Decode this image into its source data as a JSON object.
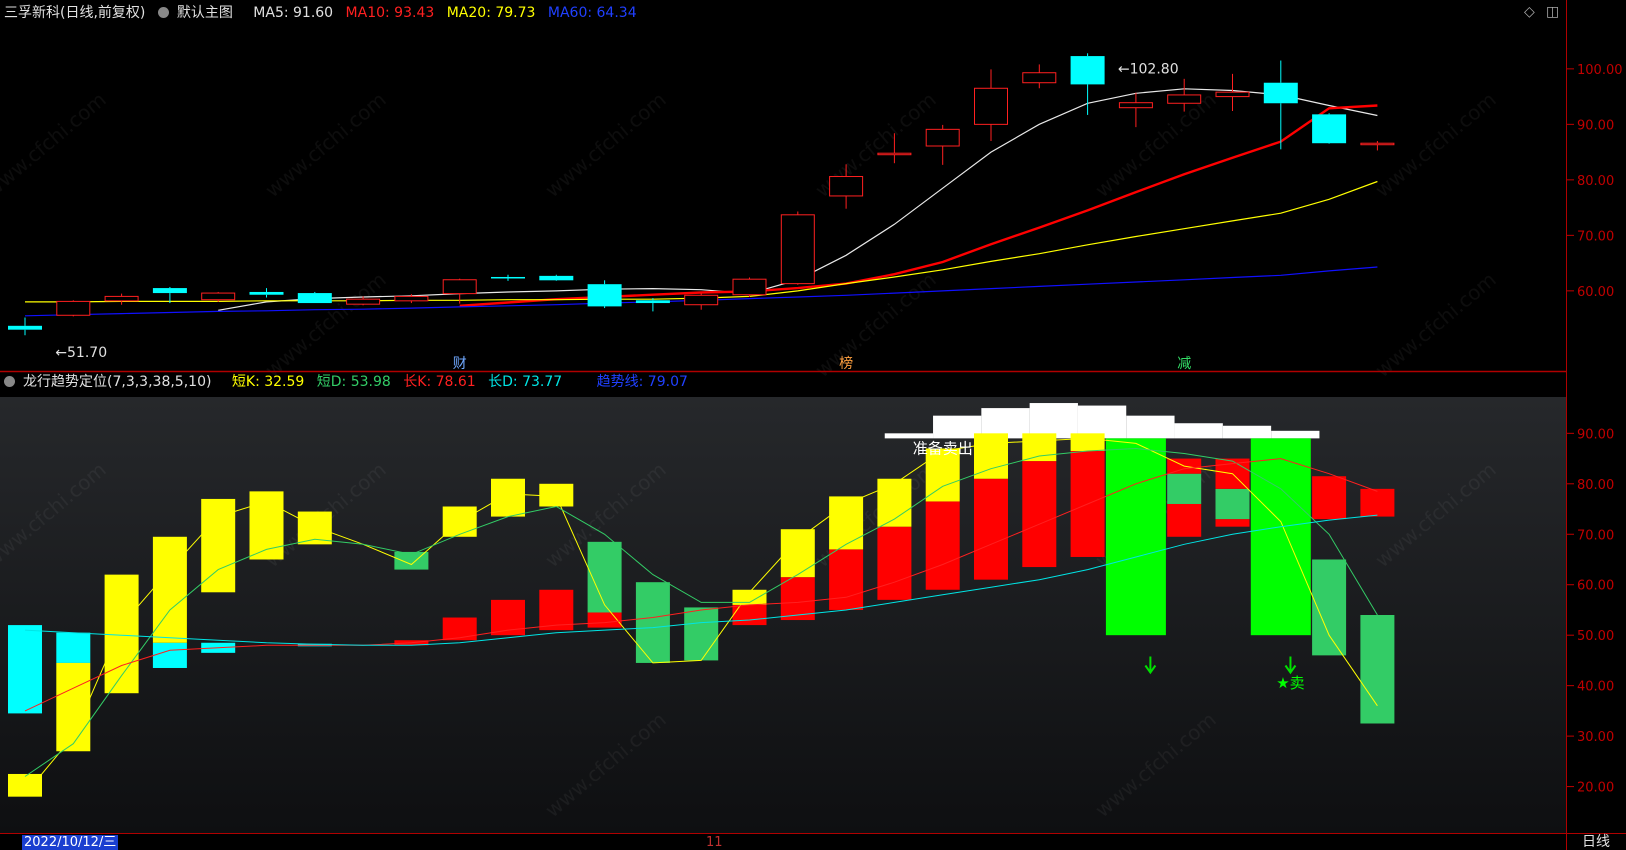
{
  "colors": {
    "bg": "#000000",
    "up": "#ff2020",
    "down": "#00ffff",
    "ma5": "#e8e8e8",
    "ma10": "#ff0000",
    "ma20": "#ffff00",
    "ma60": "#1010ff",
    "axis": "#c00000",
    "yellow": "#ffff00",
    "red": "#ff0000",
    "cyan": "#00ffff",
    "ltgreen": "#33cc66",
    "green": "#00ff00",
    "white": "#ffffff"
  },
  "header": {
    "stock": "三孚新科",
    "period": "(日线,前复权)",
    "main_label": "默认主图",
    "ma5": "MA5: 91.60",
    "ma10": "MA10: 93.43",
    "ma20": "MA20: 79.73",
    "ma60": "MA60: 64.34"
  },
  "toolbar": {
    "diamond_icon": "◇",
    "layout_icon": "◫"
  },
  "indicator": {
    "name": "龙行趋势定位(7,3,3,38,5,10)",
    "short_k": "短K: 32.59",
    "short_d": "短D: 53.98",
    "long_k": "长K: 78.61",
    "long_d": "长D: 73.77",
    "trend": "趋势线: 79.07"
  },
  "footer": {
    "date": "2022/10/12/三",
    "month_mark": "11",
    "period_btn": "日线"
  },
  "chart_data": [
    {
      "type": "candlestick",
      "yticks": [
        60,
        70,
        80,
        90,
        100
      ],
      "ytick_labels": [
        "60.00",
        "70.00",
        "80.00",
        "90.00",
        "100.00"
      ],
      "ylim": [
        47,
        107
      ],
      "annotations": [
        {
          "text": "←51.70",
          "x": 1,
          "y": 51.7
        },
        {
          "text": "←102.80",
          "x": 23,
          "y": 102.8
        }
      ],
      "event_labels": [
        {
          "text": "财",
          "x": 9,
          "color": "#6fa8ff"
        },
        {
          "text": "榜",
          "x": 17,
          "color": "#ffa040"
        },
        {
          "text": "减",
          "x": 24,
          "color": "#33dd66"
        }
      ],
      "candles": [
        {
          "o": 53.7,
          "h": 55.2,
          "l": 52.0,
          "c": 53.0
        },
        {
          "o": 55.6,
          "h": 58.3,
          "l": 55.4,
          "c": 58.1
        },
        {
          "o": 58.2,
          "h": 59.5,
          "l": 57.5,
          "c": 59.0
        },
        {
          "o": 60.5,
          "h": 60.7,
          "l": 57.8,
          "c": 59.6
        },
        {
          "o": 58.4,
          "h": 59.8,
          "l": 58.0,
          "c": 59.6
        },
        {
          "o": 59.8,
          "h": 60.5,
          "l": 58.8,
          "c": 59.3
        },
        {
          "o": 59.6,
          "h": 59.8,
          "l": 57.8,
          "c": 57.8
        },
        {
          "o": 57.6,
          "h": 59.0,
          "l": 57.4,
          "c": 58.5
        },
        {
          "o": 58.2,
          "h": 59.4,
          "l": 57.8,
          "c": 59.0
        },
        {
          "o": 59.5,
          "h": 62.2,
          "l": 57.7,
          "c": 62.0
        },
        {
          "o": 62.5,
          "h": 62.9,
          "l": 61.8,
          "c": 62.3
        },
        {
          "o": 62.7,
          "h": 62.9,
          "l": 61.8,
          "c": 61.9
        },
        {
          "o": 61.2,
          "h": 61.9,
          "l": 56.9,
          "c": 57.2
        },
        {
          "o": 58.3,
          "h": 58.7,
          "l": 56.3,
          "c": 57.8
        },
        {
          "o": 57.5,
          "h": 59.6,
          "l": 56.6,
          "c": 59.2
        },
        {
          "o": 59.3,
          "h": 62.4,
          "l": 58.9,
          "c": 62.1
        },
        {
          "o": 61.3,
          "h": 74.3,
          "l": 61.1,
          "c": 73.7
        },
        {
          "o": 77.1,
          "h": 82.8,
          "l": 74.8,
          "c": 80.6
        },
        {
          "o": 84.8,
          "h": 88.4,
          "l": 83.0,
          "c": 84.8
        },
        {
          "o": 86.1,
          "h": 89.9,
          "l": 82.7,
          "c": 89.1
        },
        {
          "o": 90.0,
          "h": 99.9,
          "l": 87.0,
          "c": 96.5
        },
        {
          "o": 97.5,
          "h": 100.8,
          "l": 96.5,
          "c": 99.3
        },
        {
          "o": 102.3,
          "h": 102.8,
          "l": 91.7,
          "c": 97.2
        },
        {
          "o": 93.0,
          "h": 95.7,
          "l": 89.5,
          "c": 93.9
        },
        {
          "o": 93.8,
          "h": 98.2,
          "l": 92.3,
          "c": 95.3
        },
        {
          "o": 95.0,
          "h": 99.1,
          "l": 92.4,
          "c": 95.8
        },
        {
          "o": 97.5,
          "h": 101.5,
          "l": 85.5,
          "c": 93.8
        },
        {
          "o": 91.8,
          "h": 92.0,
          "l": 86.5,
          "c": 86.6
        },
        {
          "o": 86.6,
          "h": 87.0,
          "l": 85.3,
          "c": 86.6
        }
      ],
      "series": [
        {
          "name": "MA5",
          "values": [
            null,
            null,
            null,
            null,
            56.5,
            58.0,
            58.6,
            58.9,
            59.1,
            59.5,
            59.8,
            60.0,
            60.3,
            60.4,
            60.2,
            59.5,
            62.0,
            66.4,
            72.0,
            78.5,
            85.0,
            90.0,
            93.8,
            95.6,
            96.4,
            96.1,
            95.3,
            93.4,
            91.6
          ]
        },
        {
          "name": "MA10",
          "values": [
            null,
            null,
            null,
            null,
            null,
            null,
            null,
            null,
            null,
            57.3,
            57.9,
            58.5,
            58.9,
            59.3,
            59.7,
            59.9,
            60.5,
            61.3,
            63.0,
            65.2,
            68.4,
            71.4,
            74.5,
            77.8,
            81.0,
            84.0,
            86.9,
            92.9,
            93.4
          ]
        },
        {
          "name": "MA20",
          "values": [
            58.0,
            58.0,
            58.1,
            58.1,
            58.1,
            58.2,
            58.2,
            58.2,
            58.3,
            58.3,
            58.4,
            58.4,
            58.5,
            58.5,
            58.7,
            59.0,
            60.0,
            61.3,
            62.5,
            63.8,
            65.3,
            66.7,
            68.3,
            69.8,
            71.2,
            72.6,
            74.0,
            76.5,
            79.7
          ]
        },
        {
          "name": "MA60",
          "values": [
            55.5,
            55.7,
            55.9,
            56.1,
            56.3,
            56.4,
            56.6,
            56.7,
            56.9,
            57.1,
            57.3,
            57.5,
            57.8,
            58.0,
            58.3,
            58.6,
            58.9,
            59.2,
            59.6,
            60.0,
            60.4,
            60.8,
            61.2,
            61.6,
            62.0,
            62.4,
            62.8,
            63.6,
            64.3
          ]
        }
      ]
    },
    {
      "type": "bar",
      "yticks": [
        20,
        30,
        40,
        50,
        60,
        70,
        80,
        90
      ],
      "ytick_labels": [
        "20.00",
        "30.00",
        "40.00",
        "50.00",
        "60.00",
        "70.00",
        "80.00",
        "90.00"
      ],
      "ylim": [
        11,
        97
      ],
      "bars": [
        {
          "x": 0,
          "from": 34.5,
          "to": 52.0,
          "color": "cyan"
        },
        {
          "x": 0,
          "from": 18.0,
          "to": 22.5,
          "color": "yellow"
        },
        {
          "x": 1,
          "from": 44.5,
          "to": 50.5,
          "color": "cyan"
        },
        {
          "x": 1,
          "from": 27.0,
          "to": 44.5,
          "color": "yellow"
        },
        {
          "x": 2,
          "from": 38.5,
          "to": 62.0,
          "color": "yellow"
        },
        {
          "x": 3,
          "from": 43.5,
          "to": 48.5,
          "color": "cyan"
        },
        {
          "x": 3,
          "from": 48.5,
          "to": 69.5,
          "color": "yellow"
        },
        {
          "x": 4,
          "from": 46.5,
          "to": 48.5,
          "color": "cyan"
        },
        {
          "x": 4,
          "from": 58.5,
          "to": 77.0,
          "color": "yellow"
        },
        {
          "x": 5,
          "from": 65.0,
          "to": 78.5,
          "color": "yellow"
        },
        {
          "x": 6,
          "from": 47.8,
          "to": 48.3,
          "color": "cyan"
        },
        {
          "x": 6,
          "from": 68.0,
          "to": 74.5,
          "color": "yellow"
        },
        {
          "x": 8,
          "from": 63.0,
          "to": 66.5,
          "color": "ltgreen"
        },
        {
          "x": 8,
          "from": 48.0,
          "to": 49.0,
          "color": "red"
        },
        {
          "x": 9,
          "from": 49.0,
          "to": 53.5,
          "color": "red"
        },
        {
          "x": 9,
          "from": 69.5,
          "to": 75.5,
          "color": "yellow"
        },
        {
          "x": 10,
          "from": 50.0,
          "to": 57.0,
          "color": "red"
        },
        {
          "x": 10,
          "from": 73.5,
          "to": 81.0,
          "color": "yellow"
        },
        {
          "x": 11,
          "from": 51.0,
          "to": 59.0,
          "color": "red"
        },
        {
          "x": 11,
          "from": 75.5,
          "to": 80.0,
          "color": "yellow"
        },
        {
          "x": 12,
          "from": 51.5,
          "to": 54.5,
          "color": "red"
        },
        {
          "x": 12,
          "from": 54.5,
          "to": 68.5,
          "color": "ltgreen"
        },
        {
          "x": 13,
          "from": 44.5,
          "to": 60.5,
          "color": "ltgreen"
        },
        {
          "x": 14,
          "from": 45.0,
          "to": 55.5,
          "color": "ltgreen"
        },
        {
          "x": 15,
          "from": 52.0,
          "to": 56.0,
          "color": "red"
        },
        {
          "x": 15,
          "from": 56.0,
          "to": 59.0,
          "color": "yellow"
        },
        {
          "x": 16,
          "from": 53.0,
          "to": 61.5,
          "color": "red"
        },
        {
          "x": 16,
          "from": 61.5,
          "to": 71.0,
          "color": "yellow"
        },
        {
          "x": 17,
          "from": 55.0,
          "to": 67.0,
          "color": "red"
        },
        {
          "x": 17,
          "from": 67.0,
          "to": 77.5,
          "color": "yellow"
        },
        {
          "x": 18,
          "from": 57.0,
          "to": 71.5,
          "color": "red"
        },
        {
          "x": 18,
          "from": 71.5,
          "to": 81.0,
          "color": "yellow"
        },
        {
          "x": 19,
          "from": 59.0,
          "to": 76.5,
          "color": "red"
        },
        {
          "x": 19,
          "from": 76.5,
          "to": 87.0,
          "color": "yellow"
        },
        {
          "x": 20,
          "from": 61.0,
          "to": 81.0,
          "color": "red"
        },
        {
          "x": 20,
          "from": 81.0,
          "to": 90.0,
          "color": "yellow"
        },
        {
          "x": 21,
          "from": 63.5,
          "to": 84.5,
          "color": "red"
        },
        {
          "x": 21,
          "from": 84.5,
          "to": 90.0,
          "color": "yellow"
        },
        {
          "x": 22,
          "from": 65.5,
          "to": 86.5,
          "color": "red"
        },
        {
          "x": 22,
          "from": 86.5,
          "to": 90.0,
          "color": "yellow"
        },
        {
          "x": 23,
          "from": 50.0,
          "to": 89.0,
          "color": "green"
        },
        {
          "x": 24,
          "from": 69.5,
          "to": 76.0,
          "color": "red"
        },
        {
          "x": 24,
          "from": 76.0,
          "to": 82.0,
          "color": "ltgreen"
        },
        {
          "x": 24,
          "from": 82.0,
          "to": 85.0,
          "color": "red"
        },
        {
          "x": 25,
          "from": 71.5,
          "to": 73.0,
          "color": "red"
        },
        {
          "x": 25,
          "from": 73.0,
          "to": 79.0,
          "color": "ltgreen"
        },
        {
          "x": 25,
          "from": 79.0,
          "to": 85.0,
          "color": "red"
        },
        {
          "x": 26,
          "from": 50.0,
          "to": 89.0,
          "color": "green"
        },
        {
          "x": 27,
          "from": 73.0,
          "to": 81.5,
          "color": "red"
        },
        {
          "x": 27,
          "from": 46.0,
          "to": 65.0,
          "color": "ltgreen"
        },
        {
          "x": 28,
          "from": 73.5,
          "to": 79.0,
          "color": "red"
        },
        {
          "x": 28,
          "from": 32.5,
          "to": 54.0,
          "color": "ltgreen"
        }
      ],
      "white_blocks": [
        {
          "x0": 17.8,
          "x1": 18.8,
          "from": 89.0,
          "to": 90.0
        },
        {
          "x0": 18.8,
          "x1": 19.8,
          "from": 89.0,
          "to": 93.5
        },
        {
          "x0": 19.8,
          "x1": 20.8,
          "from": 89.0,
          "to": 95.0
        },
        {
          "x0": 20.8,
          "x1": 21.8,
          "from": 89.0,
          "to": 96.0
        },
        {
          "x0": 21.8,
          "x1": 22.8,
          "from": 89.0,
          "to": 95.5
        },
        {
          "x0": 22.8,
          "x1": 23.8,
          "from": 89.0,
          "to": 93.5
        },
        {
          "x0": 23.8,
          "x1": 24.8,
          "from": 89.0,
          "to": 92.0
        },
        {
          "x0": 24.8,
          "x1": 25.8,
          "from": 89.0,
          "to": 91.5
        },
        {
          "x0": 25.8,
          "x1": 26.8,
          "from": 89.0,
          "to": 90.5
        }
      ],
      "texts": [
        {
          "text": "准备卖出",
          "x": 19.0,
          "y": 86.0,
          "color": "#ffffff"
        },
        {
          "text": "★卖",
          "x": 26.2,
          "y": 39.5,
          "color": "#00ff00"
        }
      ],
      "arrows": [
        {
          "x": 23.3,
          "y": 43.0
        },
        {
          "x": 26.2,
          "y": 43.0
        }
      ],
      "series": [
        {
          "name": "短K",
          "color": "#ffff00",
          "values": [
            18.5,
            30.0,
            52.0,
            63.0,
            73.5,
            76.5,
            71.5,
            68.0,
            64.0,
            72.5,
            78.0,
            77.5,
            56.0,
            44.5,
            45.0,
            58.5,
            69.0,
            76.0,
            80.0,
            86.5,
            88.0,
            88.5,
            89.0,
            88.0,
            83.5,
            82.0,
            72.5,
            50.0,
            36.0
          ]
        },
        {
          "name": "短D",
          "color": "#33cc66",
          "values": [
            22.0,
            28.5,
            42.0,
            55.0,
            63.0,
            67.0,
            69.0,
            68.0,
            66.0,
            70.0,
            73.5,
            75.5,
            70.0,
            62.0,
            56.5,
            56.5,
            62.0,
            68.0,
            73.0,
            79.5,
            83.0,
            85.5,
            86.5,
            87.0,
            86.0,
            84.5,
            79.0,
            70.0,
            54.0
          ]
        },
        {
          "name": "长K",
          "color": "#ff2020",
          "values": [
            35.0,
            39.5,
            44.0,
            47.0,
            47.5,
            48.0,
            48.0,
            48.0,
            48.5,
            49.5,
            51.0,
            52.0,
            52.5,
            53.5,
            55.0,
            56.0,
            56.5,
            57.5,
            60.5,
            64.0,
            68.0,
            72.0,
            76.0,
            80.0,
            83.0,
            84.0,
            85.0,
            82.0,
            78.5
          ]
        },
        {
          "name": "长D",
          "color": "#00e5e5",
          "values": [
            51.0,
            50.5,
            50.0,
            49.5,
            49.0,
            48.5,
            48.2,
            48.0,
            48.0,
            48.5,
            49.5,
            50.5,
            51.0,
            51.5,
            52.5,
            53.0,
            54.0,
            55.0,
            56.5,
            58.0,
            59.5,
            61.0,
            63.0,
            65.5,
            68.0,
            70.0,
            71.5,
            72.8,
            73.8
          ]
        }
      ]
    }
  ]
}
